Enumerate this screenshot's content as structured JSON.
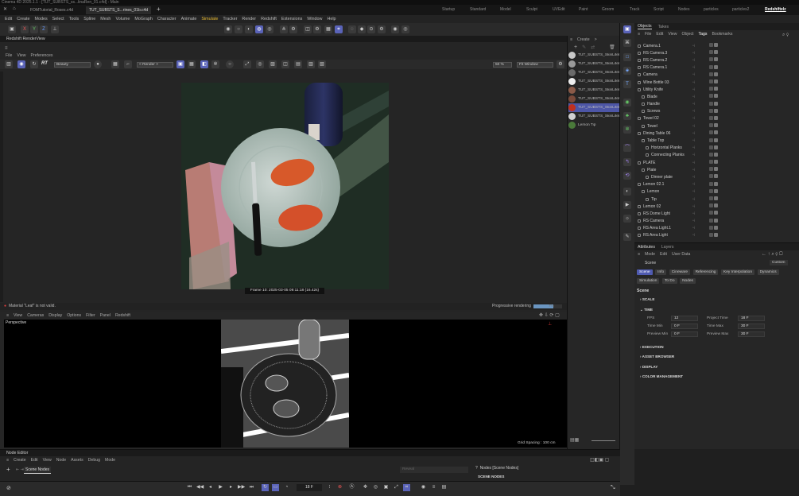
{
  "titlebar": {
    "text": "Cinema 4D 2025.1.1 - [TUT_SUBSTS_ss...linaRen_01.c4d] - Main"
  },
  "doc_tabs": [
    {
      "label": "FOMTutorial_Roses.c4d",
      "active": false
    },
    {
      "label": "TUT_SUBSTS_S...rines_01b.c4d",
      "active": true
    }
  ],
  "layout_tabs": [
    "Startup",
    "Standard",
    "Model",
    "Sculpt",
    "UVEdit",
    "Paint",
    "Groom",
    "Track",
    "Script",
    "Nodes",
    "particles",
    "particles2",
    "Redshiftelz"
  ],
  "active_layout": "Redshiftelz",
  "menu": [
    "Edit",
    "Create",
    "Modes",
    "Select",
    "Tools",
    "Spline",
    "Mesh",
    "Volume",
    "MoGraph",
    "Character",
    "Animate",
    "Simulate",
    "Tracker",
    "Render",
    "Redshift",
    "Extensions",
    "Window",
    "Help"
  ],
  "menu_highlight": "Simulate",
  "renderview": {
    "title": "Redshift RenderView",
    "menu": [
      "File",
      "View",
      "Preferences"
    ],
    "rt": "RT",
    "aov": "Beauty",
    "render_sel": "< Render >",
    "zoom": "50 %",
    "fit": "Fit Window",
    "frame_info": "Frame  10:  2025-03-05  09:11:18  (16.42s)",
    "status_warning": "Material \"Leaf\" is not valid.",
    "progressive": "Progressive rendering",
    "progress": 0.7,
    "progress_text": "7%"
  },
  "viewport": {
    "menu": [
      "View",
      "Cameras",
      "Display",
      "Options",
      "Filter",
      "Panel",
      "Redshift"
    ],
    "label": "Perspective",
    "grid": "Grid Spacing : 100 cm"
  },
  "materials": {
    "menu": [
      "Create",
      ">"
    ],
    "items": [
      {
        "name": "TUT_SUBSTS_SkinLifeLe",
        "color": "#c9c9c9",
        "selected": false
      },
      {
        "name": "TUT_SUBSTS_SkinLifeLe",
        "color": "#9a9a9a",
        "selected": false
      },
      {
        "name": "TUT_SUBSTS_SkinLifeLe",
        "color": "#6b6b6b",
        "selected": false
      },
      {
        "name": "TUT_SUBSTS_SkinLifeLe",
        "color": "#eeeeee",
        "selected": false
      },
      {
        "name": "TUT_SUBSTS_SkinLifeLe",
        "color": "#8a5a48",
        "selected": false
      },
      {
        "name": "TUT_SUBSTS_SkinLifeLe",
        "color": "#7a4a3a",
        "selected": false
      },
      {
        "name": "TUT_SUBSTS_SkinLifeLe",
        "color": "#c0301f",
        "selected": true
      },
      {
        "name": "TUT_SUBSTS_SkinLifeLe",
        "color": "#d0d0d0",
        "selected": false
      },
      {
        "name": "Lemon Tip",
        "color": "#4a7a3a",
        "selected": false
      }
    ]
  },
  "objects": {
    "tabs": [
      "Objects",
      "Takes"
    ],
    "menu": [
      "File",
      "Edit",
      "View",
      "Object",
      "Tags",
      "Bookmarks"
    ],
    "rows": [
      {
        "name": "Camera.1",
        "indent": 0,
        "sel": false
      },
      {
        "name": "RS Camera.3",
        "indent": 0,
        "sel": false
      },
      {
        "name": "RS Camera.2",
        "indent": 0,
        "sel": false
      },
      {
        "name": "RS Camera.1",
        "indent": 0,
        "sel": false
      },
      {
        "name": "Camera",
        "indent": 0,
        "sel": false
      },
      {
        "name": "Wine Bottle 03",
        "indent": 0,
        "sel": false
      },
      {
        "name": "Utility Knife",
        "indent": 0,
        "sel": false
      },
      {
        "name": "Blade",
        "indent": 1,
        "sel": false
      },
      {
        "name": "Handle",
        "indent": 1,
        "sel": false
      },
      {
        "name": "Screws",
        "indent": 1,
        "sel": false
      },
      {
        "name": "Towel 02",
        "indent": 0,
        "sel": false
      },
      {
        "name": "Towel",
        "indent": 1,
        "sel": false
      },
      {
        "name": "Dining Table 06",
        "indent": 0,
        "sel": false
      },
      {
        "name": "Table Top",
        "indent": 1,
        "sel": false
      },
      {
        "name": "Horizontal Planks",
        "indent": 2,
        "sel": false
      },
      {
        "name": "Connecting Planks",
        "indent": 2,
        "sel": false
      },
      {
        "name": "PLATE",
        "indent": 0,
        "sel": false
      },
      {
        "name": "Plate",
        "indent": 1,
        "sel": false
      },
      {
        "name": "Dinner plate",
        "indent": 2,
        "sel": false
      },
      {
        "name": "Lemon 02.1",
        "indent": 0,
        "sel": false
      },
      {
        "name": "Lemon",
        "indent": 1,
        "sel": false
      },
      {
        "name": "Tip",
        "indent": 2,
        "sel": false
      },
      {
        "name": "Lemon 02",
        "indent": 0,
        "sel": false
      },
      {
        "name": "RS Dome Light",
        "indent": 0,
        "sel": false
      },
      {
        "name": "RS Camera",
        "indent": 0,
        "sel": false
      },
      {
        "name": "RS Area Light.1",
        "indent": 0,
        "sel": false
      },
      {
        "name": "RS Area Light",
        "indent": 0,
        "sel": false
      }
    ]
  },
  "attributes": {
    "tabs": [
      "Attributes",
      "Layers"
    ],
    "menu": [
      "Mode",
      "Edit",
      "User Data"
    ],
    "scene_label": "Scene",
    "custom": "Custom",
    "buttons_row1": [
      "Scene",
      "Info",
      "Cineware",
      "Referencing",
      "Key Interpolation",
      "Dynamics"
    ],
    "buttons_row2": [
      "Simulation",
      "To Do",
      "Nodes"
    ],
    "heading": "Scene",
    "sections": [
      "SCALE",
      "TIME",
      "EXECUTION",
      "ASSET BROWSER",
      "DISPLAY",
      "COLOR MANAGEMENT"
    ],
    "fields": {
      "fps_label": "FPS",
      "fps": "12",
      "project_time_label": "Project Time",
      "project_time": "18 F",
      "time_min_label": "Time Min",
      "time_min": "0 F",
      "time_max_label": "Time Max",
      "time_max": "30 F",
      "preview_min_label": "Preview Min",
      "preview_min": "0 F",
      "preview_max_label": "Preview Max",
      "preview_max": "30 F"
    }
  },
  "node_editor": {
    "title": "Node Editor",
    "menu": [
      "Create",
      "Edit",
      "View",
      "Node",
      "Assets",
      "Debug",
      "Mode"
    ],
    "tab": "Scene Nodes",
    "search_placeholder": "Reveal",
    "right_title": "Nodes [Scene Nodes]",
    "right_sub": "SCENE NODES"
  },
  "timeline": {
    "frame": "18 F"
  },
  "colors": {
    "accent": "#5a63b8",
    "highlight_menu": "#e6b830",
    "warning": "#e04040"
  }
}
